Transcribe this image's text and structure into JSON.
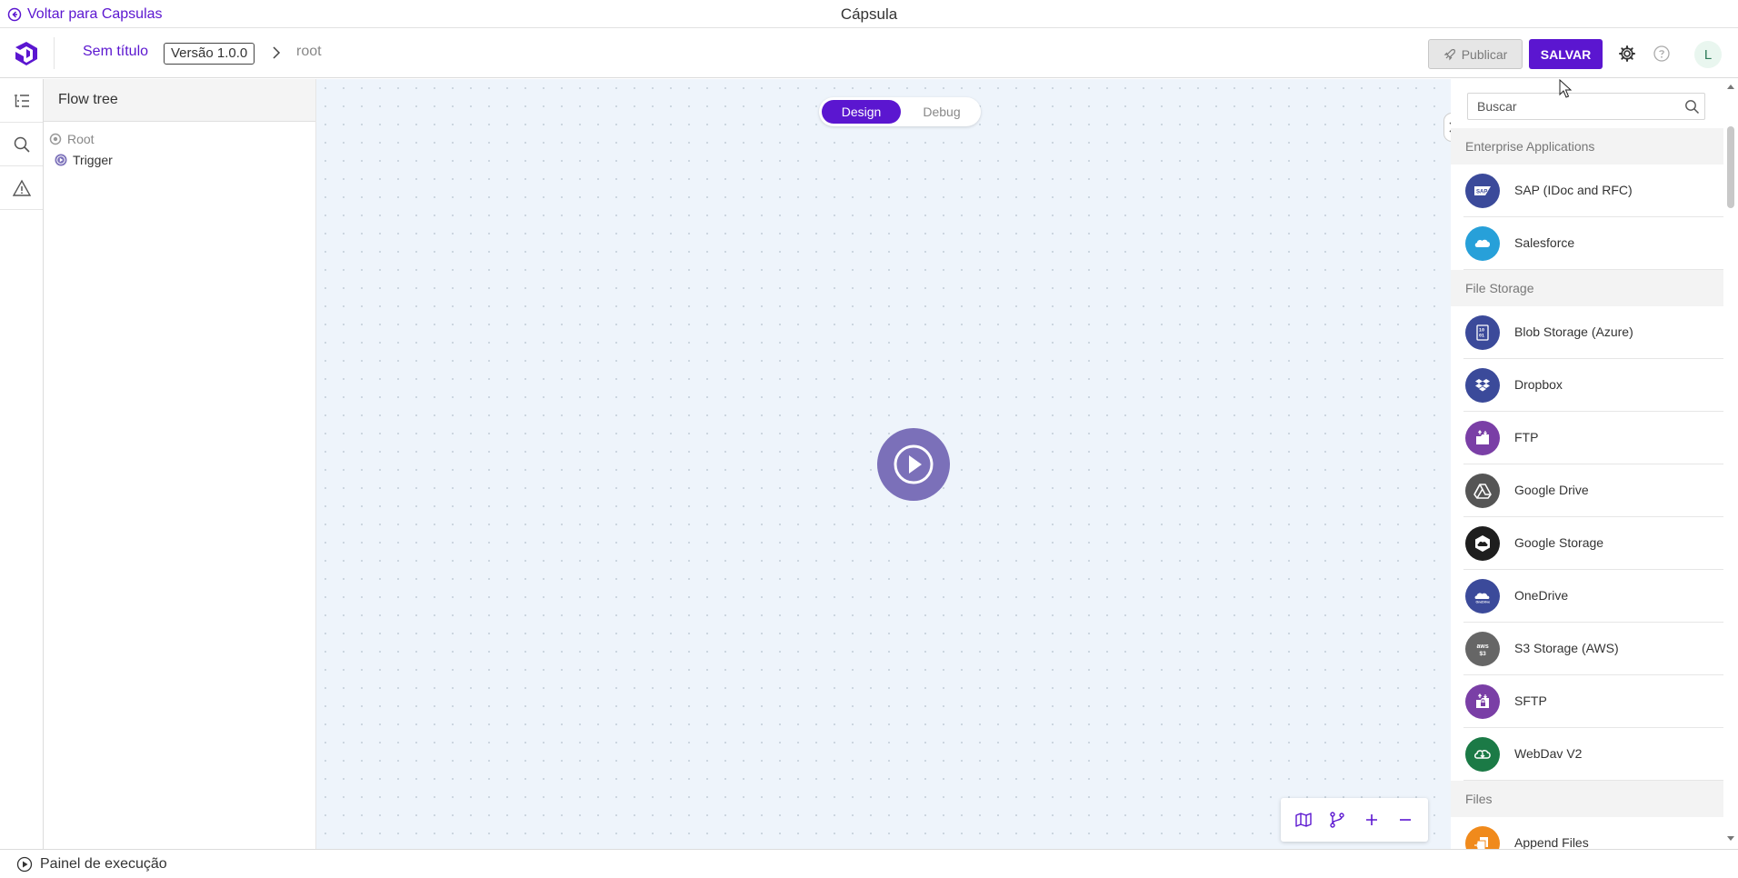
{
  "titlebar": {
    "back_label": "Voltar para Capsulas",
    "window_title": "Cápsula"
  },
  "header": {
    "doc_title": "Sem título",
    "version": "Versão 1.0.0",
    "breadcrumb_root": "root",
    "publish_label": "Publicar",
    "save_label": "SALVAR",
    "avatar_initial": "L"
  },
  "tree": {
    "title": "Flow tree",
    "nodes": [
      {
        "label": "Root"
      },
      {
        "label": "Trigger"
      }
    ]
  },
  "canvas": {
    "mode_design": "Design",
    "mode_debug": "Debug",
    "active_mode": "Design"
  },
  "connectors": {
    "search_placeholder": "Buscar",
    "categories": [
      {
        "name": "Enterprise Applications",
        "items": [
          {
            "label": "SAP (IDoc and RFC)",
            "icon": "sap-icon",
            "color": "#3b4a9a"
          },
          {
            "label": "Salesforce",
            "icon": "salesforce-cloud-icon",
            "color": "#27a0d9"
          }
        ]
      },
      {
        "name": "File Storage",
        "items": [
          {
            "label": "Blob Storage (Azure)",
            "icon": "blob-storage-icon",
            "color": "#3b4a9a"
          },
          {
            "label": "Dropbox",
            "icon": "dropbox-icon",
            "color": "#3b4a9a"
          },
          {
            "label": "FTP",
            "icon": "ftp-icon",
            "color": "#7a3fa6"
          },
          {
            "label": "Google Drive",
            "icon": "google-drive-icon",
            "color": "#555555"
          },
          {
            "label": "Google Storage",
            "icon": "google-storage-icon",
            "color": "#1e1e1e"
          },
          {
            "label": "OneDrive",
            "icon": "onedrive-icon",
            "color": "#3b4a9a"
          },
          {
            "label": "S3 Storage (AWS)",
            "icon": "aws-s3-icon",
            "color": "#666666"
          },
          {
            "label": "SFTP",
            "icon": "sftp-icon",
            "color": "#7a3fa6"
          },
          {
            "label": "WebDav V2",
            "icon": "webdav-icon",
            "color": "#1b7a46"
          }
        ]
      },
      {
        "name": "Files",
        "items": [
          {
            "label": "Append Files",
            "icon": "append-files-icon",
            "color": "#f08a1c"
          }
        ]
      }
    ]
  },
  "footer": {
    "run_panel_label": "Painel de execução"
  },
  "colors": {
    "accent": "#5b16d0",
    "trigger_node": "#7b70b9",
    "canvas_bg": "#eef4fb"
  }
}
